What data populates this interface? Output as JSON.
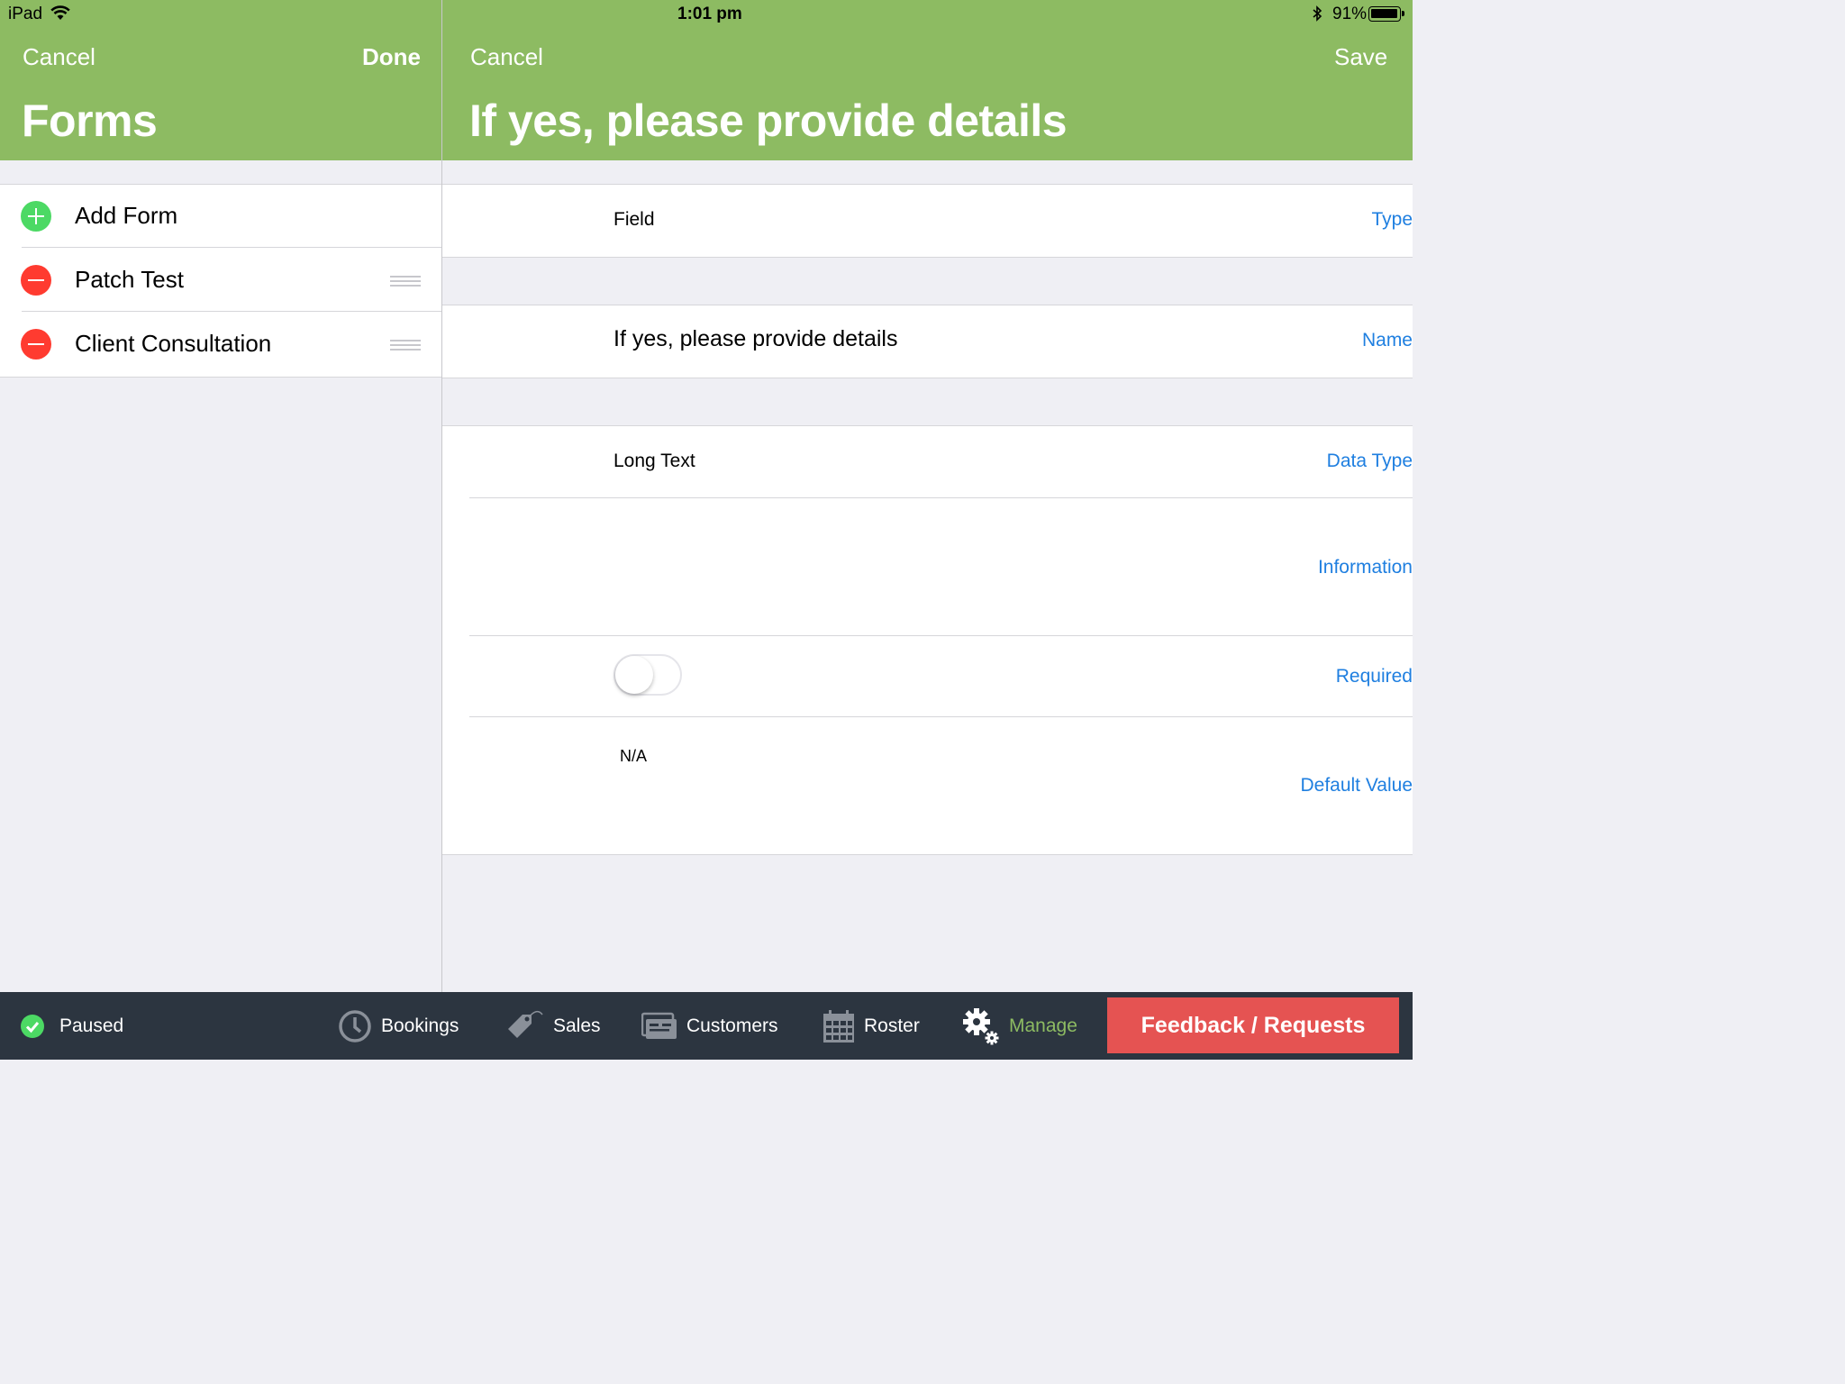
{
  "status_bar": {
    "device": "iPad",
    "time": "1:01 pm",
    "battery": "91%"
  },
  "left_pane": {
    "cancel_label": "Cancel",
    "done_label": "Done",
    "title": "Forms",
    "items": [
      {
        "label": "Add Form",
        "action": "add"
      },
      {
        "label": "Patch Test",
        "action": "delete"
      },
      {
        "label": "Client Consultation",
        "action": "delete"
      }
    ]
  },
  "right_pane": {
    "cancel_label": "Cancel",
    "save_label": "Save",
    "title": "If yes, please provide details",
    "fields": {
      "type": {
        "label": "Type",
        "value": "Field"
      },
      "name": {
        "label": "Name",
        "value": "If yes, please provide details"
      },
      "data_type": {
        "label": "Data Type",
        "value": "Long Text"
      },
      "information": {
        "label": "Information",
        "value": ""
      },
      "required": {
        "label": "Required",
        "on": false
      },
      "default_value": {
        "label": "Default Value",
        "value": "N/A"
      }
    }
  },
  "tab_bar": {
    "status_label": "Paused",
    "tabs": [
      {
        "label": "Bookings",
        "icon": "clock-icon"
      },
      {
        "label": "Sales",
        "icon": "price-tag-icon"
      },
      {
        "label": "Customers",
        "icon": "customers-icon"
      },
      {
        "label": "Roster",
        "icon": "calendar-icon"
      },
      {
        "label": "Manage",
        "icon": "gears-icon",
        "active": true
      }
    ],
    "feedback_label": "Feedback / Requests"
  },
  "colors": {
    "header_green": "#8dbb62",
    "link_blue": "#1f7fe0",
    "add_green": "#4cd964",
    "delete_red": "#ff3b30",
    "tabbar_bg": "#2c3540",
    "feedback_red": "#e55352"
  }
}
